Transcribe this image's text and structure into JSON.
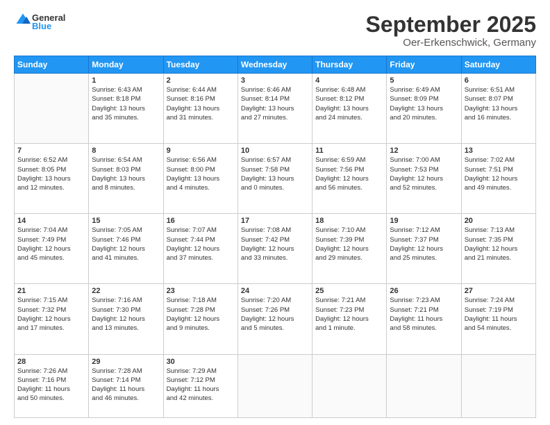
{
  "logo": {
    "general": "General",
    "blue": "Blue"
  },
  "header": {
    "month": "September 2025",
    "location": "Oer-Erkenschwick, Germany"
  },
  "days_of_week": [
    "Sunday",
    "Monday",
    "Tuesday",
    "Wednesday",
    "Thursday",
    "Friday",
    "Saturday"
  ],
  "weeks": [
    [
      {
        "num": "",
        "info": ""
      },
      {
        "num": "1",
        "info": "Sunrise: 6:43 AM\nSunset: 8:18 PM\nDaylight: 13 hours\nand 35 minutes."
      },
      {
        "num": "2",
        "info": "Sunrise: 6:44 AM\nSunset: 8:16 PM\nDaylight: 13 hours\nand 31 minutes."
      },
      {
        "num": "3",
        "info": "Sunrise: 6:46 AM\nSunset: 8:14 PM\nDaylight: 13 hours\nand 27 minutes."
      },
      {
        "num": "4",
        "info": "Sunrise: 6:48 AM\nSunset: 8:12 PM\nDaylight: 13 hours\nand 24 minutes."
      },
      {
        "num": "5",
        "info": "Sunrise: 6:49 AM\nSunset: 8:09 PM\nDaylight: 13 hours\nand 20 minutes."
      },
      {
        "num": "6",
        "info": "Sunrise: 6:51 AM\nSunset: 8:07 PM\nDaylight: 13 hours\nand 16 minutes."
      }
    ],
    [
      {
        "num": "7",
        "info": "Sunrise: 6:52 AM\nSunset: 8:05 PM\nDaylight: 13 hours\nand 12 minutes."
      },
      {
        "num": "8",
        "info": "Sunrise: 6:54 AM\nSunset: 8:03 PM\nDaylight: 13 hours\nand 8 minutes."
      },
      {
        "num": "9",
        "info": "Sunrise: 6:56 AM\nSunset: 8:00 PM\nDaylight: 13 hours\nand 4 minutes."
      },
      {
        "num": "10",
        "info": "Sunrise: 6:57 AM\nSunset: 7:58 PM\nDaylight: 13 hours\nand 0 minutes."
      },
      {
        "num": "11",
        "info": "Sunrise: 6:59 AM\nSunset: 7:56 PM\nDaylight: 12 hours\nand 56 minutes."
      },
      {
        "num": "12",
        "info": "Sunrise: 7:00 AM\nSunset: 7:53 PM\nDaylight: 12 hours\nand 52 minutes."
      },
      {
        "num": "13",
        "info": "Sunrise: 7:02 AM\nSunset: 7:51 PM\nDaylight: 12 hours\nand 49 minutes."
      }
    ],
    [
      {
        "num": "14",
        "info": "Sunrise: 7:04 AM\nSunset: 7:49 PM\nDaylight: 12 hours\nand 45 minutes."
      },
      {
        "num": "15",
        "info": "Sunrise: 7:05 AM\nSunset: 7:46 PM\nDaylight: 12 hours\nand 41 minutes."
      },
      {
        "num": "16",
        "info": "Sunrise: 7:07 AM\nSunset: 7:44 PM\nDaylight: 12 hours\nand 37 minutes."
      },
      {
        "num": "17",
        "info": "Sunrise: 7:08 AM\nSunset: 7:42 PM\nDaylight: 12 hours\nand 33 minutes."
      },
      {
        "num": "18",
        "info": "Sunrise: 7:10 AM\nSunset: 7:39 PM\nDaylight: 12 hours\nand 29 minutes."
      },
      {
        "num": "19",
        "info": "Sunrise: 7:12 AM\nSunset: 7:37 PM\nDaylight: 12 hours\nand 25 minutes."
      },
      {
        "num": "20",
        "info": "Sunrise: 7:13 AM\nSunset: 7:35 PM\nDaylight: 12 hours\nand 21 minutes."
      }
    ],
    [
      {
        "num": "21",
        "info": "Sunrise: 7:15 AM\nSunset: 7:32 PM\nDaylight: 12 hours\nand 17 minutes."
      },
      {
        "num": "22",
        "info": "Sunrise: 7:16 AM\nSunset: 7:30 PM\nDaylight: 12 hours\nand 13 minutes."
      },
      {
        "num": "23",
        "info": "Sunrise: 7:18 AM\nSunset: 7:28 PM\nDaylight: 12 hours\nand 9 minutes."
      },
      {
        "num": "24",
        "info": "Sunrise: 7:20 AM\nSunset: 7:26 PM\nDaylight: 12 hours\nand 5 minutes."
      },
      {
        "num": "25",
        "info": "Sunrise: 7:21 AM\nSunset: 7:23 PM\nDaylight: 12 hours\nand 1 minute."
      },
      {
        "num": "26",
        "info": "Sunrise: 7:23 AM\nSunset: 7:21 PM\nDaylight: 11 hours\nand 58 minutes."
      },
      {
        "num": "27",
        "info": "Sunrise: 7:24 AM\nSunset: 7:19 PM\nDaylight: 11 hours\nand 54 minutes."
      }
    ],
    [
      {
        "num": "28",
        "info": "Sunrise: 7:26 AM\nSunset: 7:16 PM\nDaylight: 11 hours\nand 50 minutes."
      },
      {
        "num": "29",
        "info": "Sunrise: 7:28 AM\nSunset: 7:14 PM\nDaylight: 11 hours\nand 46 minutes."
      },
      {
        "num": "30",
        "info": "Sunrise: 7:29 AM\nSunset: 7:12 PM\nDaylight: 11 hours\nand 42 minutes."
      },
      {
        "num": "",
        "info": ""
      },
      {
        "num": "",
        "info": ""
      },
      {
        "num": "",
        "info": ""
      },
      {
        "num": "",
        "info": ""
      }
    ]
  ]
}
